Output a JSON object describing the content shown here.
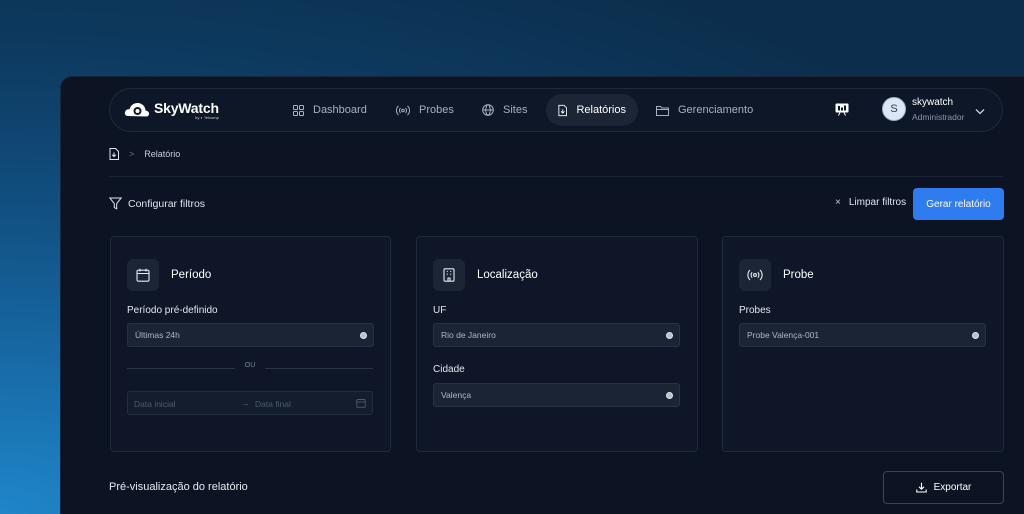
{
  "app": {
    "logo_title": "SkyWatch",
    "logo_sub": "by ◐ Telcomp"
  },
  "nav": {
    "items": [
      {
        "label": "Dashboard",
        "icon": "grid-icon"
      },
      {
        "label": "Probes",
        "icon": "broadcast-icon"
      },
      {
        "label": "Sites",
        "icon": "globe-icon"
      },
      {
        "label": "Relatórios",
        "icon": "report-file-icon",
        "active": true
      },
      {
        "label": "Gerenciamento",
        "icon": "folder-icon"
      }
    ]
  },
  "user": {
    "initial": "S",
    "name": "skywatch",
    "role": "Administrador"
  },
  "breadcrumb": {
    "separator": ">",
    "current": "Relatório"
  },
  "toolbar": {
    "filters_label": "Configurar filtros",
    "clear_label": "Limpar filtros",
    "clear_icon": "×",
    "generate_label": "Gerar relatório"
  },
  "cards": {
    "period": {
      "title": "Período",
      "preset_label": "Período pré-definido",
      "preset_value": "Últimas 24h",
      "or_label": "OU",
      "start_placeholder": "Data inicial",
      "range_arrow": "→",
      "end_placeholder": "Data final"
    },
    "location": {
      "title": "Localização",
      "uf_label": "UF",
      "uf_value": "Rio de Janeiro",
      "city_label": "Cidade",
      "city_value": "Valença"
    },
    "probe": {
      "title": "Probe",
      "probes_label": "Probes",
      "probes_value": "Probe Valença-001"
    }
  },
  "preview": {
    "title": "Pré-visualização do relatório",
    "export_label": "Exportar"
  },
  "colors": {
    "accent": "#2f7cf0",
    "panel": "#0c1424",
    "card": "#0e1627"
  }
}
